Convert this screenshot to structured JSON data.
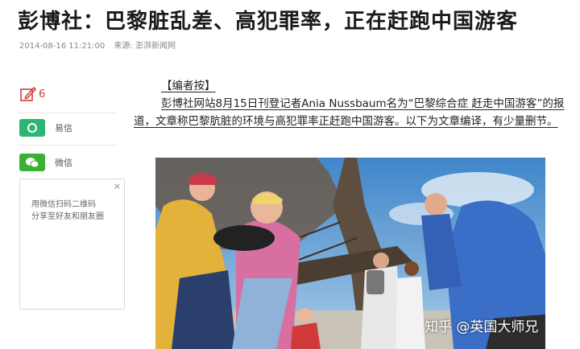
{
  "headline": "彭博社：巴黎脏乱差、高犯罪率，正在赶跑中国游客",
  "meta": {
    "date": "2014-08-16 11:21:00",
    "source": "来源: 澎湃新闻网"
  },
  "share": {
    "comment_count": "6",
    "yixin_label": "易信",
    "weixin_label": "微信",
    "qr_close": "×",
    "qr_line1": "用微信扫码二维码",
    "qr_line2": "分享至好友和朋友圈"
  },
  "article": {
    "editor_note": "【编者按】",
    "intro": "彭博社网站8月15日刊登记者Ania Nussbaum名为“巴黎综合症 赶走中国游客”的报道，文章称巴黎肮脏的环境与高犯罪率正赶跑中国游客。以下为文章编译，有少量删节。"
  },
  "photo": {
    "watermark": "知乎 @英国大师兄"
  },
  "colors": {
    "accent_red": "#d23c3c",
    "yixin_green": "#2bb673",
    "weixin_green": "#3cb034"
  },
  "icons": {
    "comment": "comment-edit-icon",
    "yixin": "yixin-icon",
    "weixin": "wechat-icon"
  }
}
